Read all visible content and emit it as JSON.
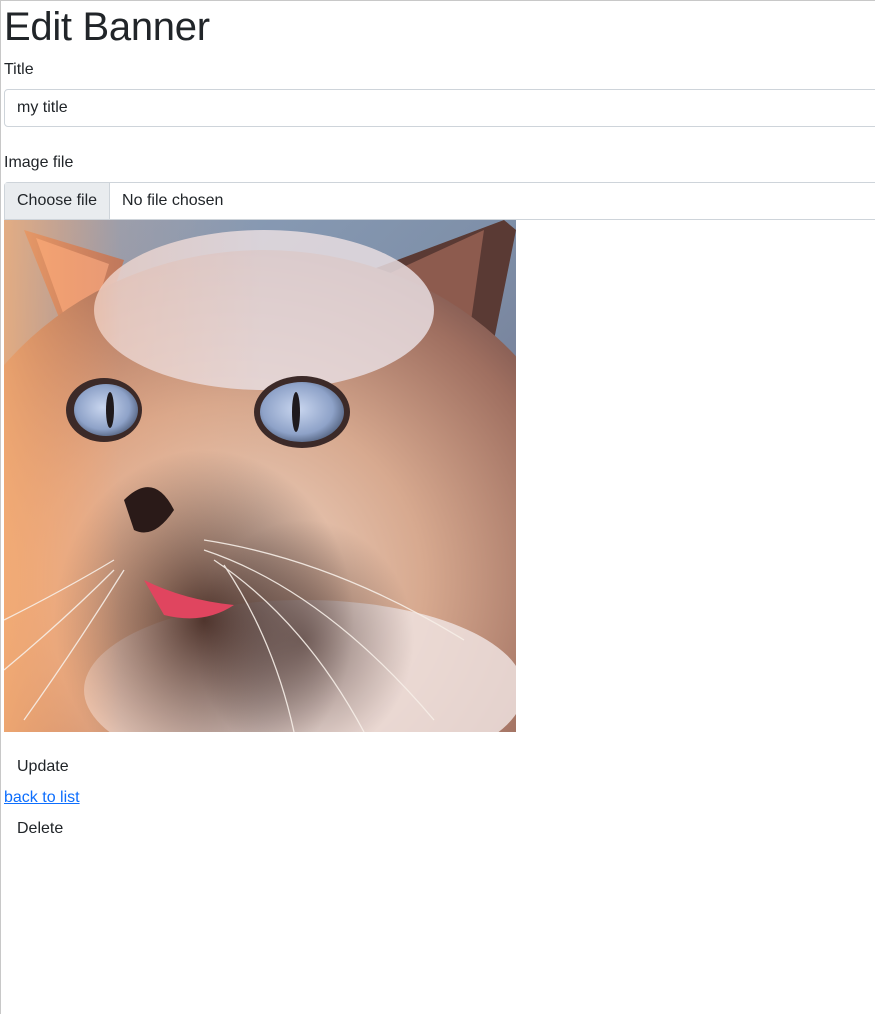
{
  "page": {
    "title": "Edit Banner"
  },
  "form": {
    "title_label": "Title",
    "title_value": "my title",
    "image_label": "Image file",
    "file_button_label": "Choose file",
    "file_status": "No file chosen"
  },
  "preview": {
    "alt": "cat",
    "icon": "cat-photo"
  },
  "actions": {
    "update_label": "Update",
    "back_link_label": "back to list",
    "delete_label": "Delete"
  },
  "colors": {
    "link": "#0d6efd",
    "file_button_bg": "#e9ecef",
    "border": "#ced4da"
  }
}
